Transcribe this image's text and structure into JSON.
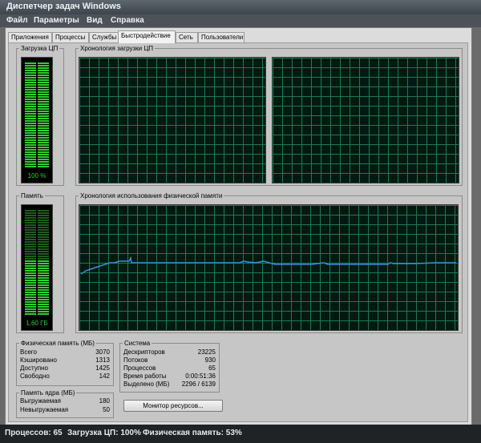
{
  "window": {
    "title": "Диспетчер задач Windows"
  },
  "menu": [
    "Файл",
    "Параметры",
    "Вид",
    "Справка"
  ],
  "tabs": [
    "Приложения",
    "Процессы",
    "Службы",
    "Быстродействие",
    "Сеть",
    "Пользователи"
  ],
  "active_tab": "Быстродействие",
  "cpu": {
    "meter_title": "Загрузка ЦП",
    "usage_percent": 100,
    "usage_label": "100 %",
    "history_title": "Хронология загрузки ЦП",
    "cores": 2
  },
  "memory": {
    "meter_title": "Память",
    "usage_fraction": 0.53,
    "usage_label": "1,60 ГБ",
    "history_title": "Хронология использования физической памяти"
  },
  "physical_memory": {
    "title": "Физическая память (МБ)",
    "rows": [
      {
        "label": "Всего",
        "value": "3070"
      },
      {
        "label": "Кэшировано",
        "value": "1313"
      },
      {
        "label": "Доступно",
        "value": "1425"
      },
      {
        "label": "Свободно",
        "value": "142"
      }
    ]
  },
  "kernel_memory": {
    "title": "Память ядра (МБ)",
    "rows": [
      {
        "label": "Выгружаемая",
        "value": "180"
      },
      {
        "label": "Невыгружаемая",
        "value": "50"
      }
    ]
  },
  "system": {
    "title": "Система",
    "rows": [
      {
        "label": "Дескрипторов",
        "value": "23225"
      },
      {
        "label": "Потоков",
        "value": "930"
      },
      {
        "label": "Процессов",
        "value": "65"
      },
      {
        "label": "Время работы",
        "value": "0:00:51:36"
      },
      {
        "label": "Выделено (МБ)",
        "value": "2296 / 6139"
      }
    ]
  },
  "resource_monitor_button": "Монитор ресурсов...",
  "status": {
    "processes": "Процессов: 65",
    "cpu": "Загрузка ЦП: 100%",
    "memory": "Физическая память: 53%"
  },
  "colors": {
    "meter_on": "#2ed02e",
    "meter_off": "#1e5d1e",
    "grid": "#1d7a53",
    "memory_line": "#3a8fd6"
  }
}
